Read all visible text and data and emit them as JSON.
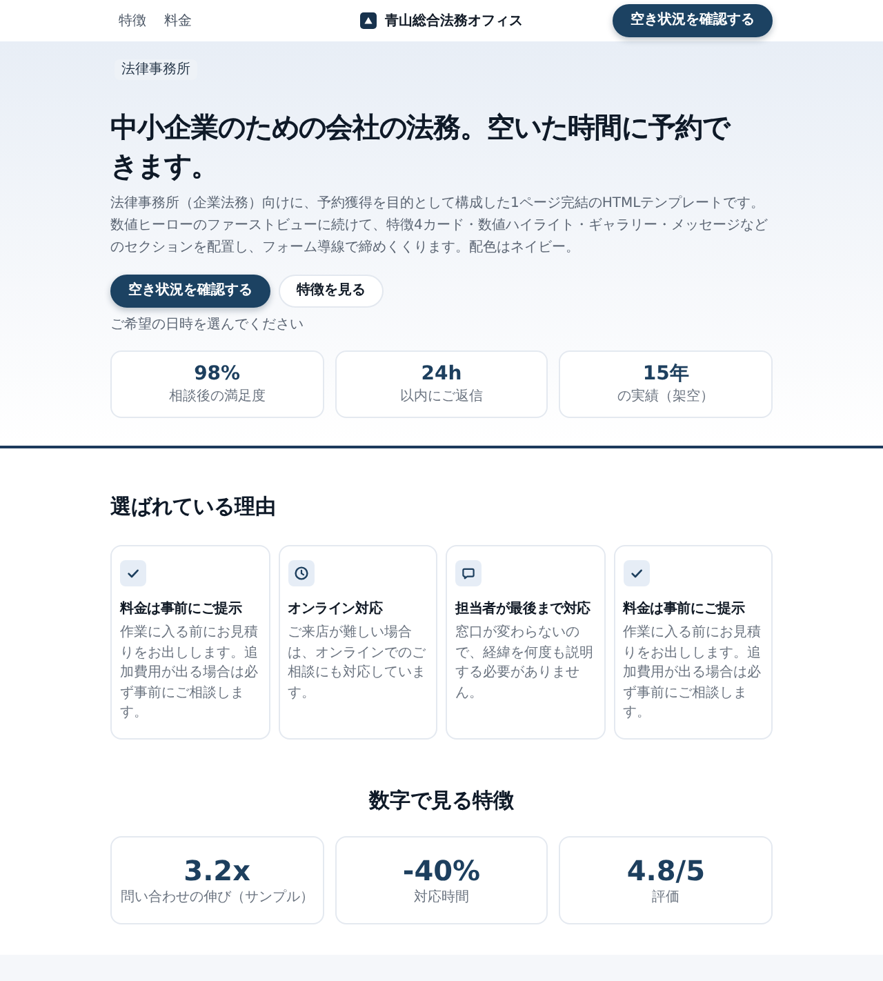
{
  "header": {
    "nav": [
      "特徴",
      "料金"
    ],
    "brand": "青山総合法務オフィス",
    "cta": "空き状況を確認する"
  },
  "hero": {
    "badge": "法律事務所",
    "title": "中小企業のための会社の法務。空いた時間に予約できます。",
    "lead": "法律事務所（企業法務）向けに、予約獲得を目的として構成した1ページ完結のHTMLテンプレートです。数値ヒーローのファーストビューに続けて、特徴4カード・数値ハイライト・ギャラリー・メッセージなどのセクションを配置し、フォーム導線で締めくくります。配色はネイビー。",
    "buttons": [
      {
        "label": "空き状況を確認する",
        "kind": "primary"
      },
      {
        "label": "特徴を見る",
        "kind": "secondary"
      }
    ],
    "hint": "ご希望の日時を選んでください",
    "stats": [
      {
        "value": "98%",
        "label": "相談後の満足度"
      },
      {
        "value": "24h",
        "label": "以内にご返信"
      },
      {
        "value": "15年",
        "label": "の実績（架空）"
      }
    ]
  },
  "reasons": {
    "title": "選ばれている理由",
    "cards": [
      {
        "kind": "check",
        "title": "料金は事前にご提示",
        "text": "作業に入る前にお見積りをお出しします。追加費用が出る場合は必ず事前にご相談します。"
      },
      {
        "kind": "clock",
        "title": "オンライン対応",
        "text": "ご来店が難しい場合は、オンラインでのご相談にも対応しています。"
      },
      {
        "kind": "message",
        "title": "担当者が最後まで対応",
        "text": "窓口が変わらないので、経緯を何度も説明する必要がありません。"
      },
      {
        "kind": "check",
        "title": "料金は事前にご提示",
        "text": "作業に入る前にお見積りをお出しします。追加費用が出る場合は必ず事前にご相談します。"
      }
    ]
  },
  "highlights": {
    "title": "数字で見る特徴",
    "stats": [
      {
        "value": "3.2x",
        "label": "問い合わせの伸び（サンプル）"
      },
      {
        "value": "-40%",
        "label": "対応時間"
      },
      {
        "value": "4.8/5",
        "label": "評価"
      }
    ]
  }
}
